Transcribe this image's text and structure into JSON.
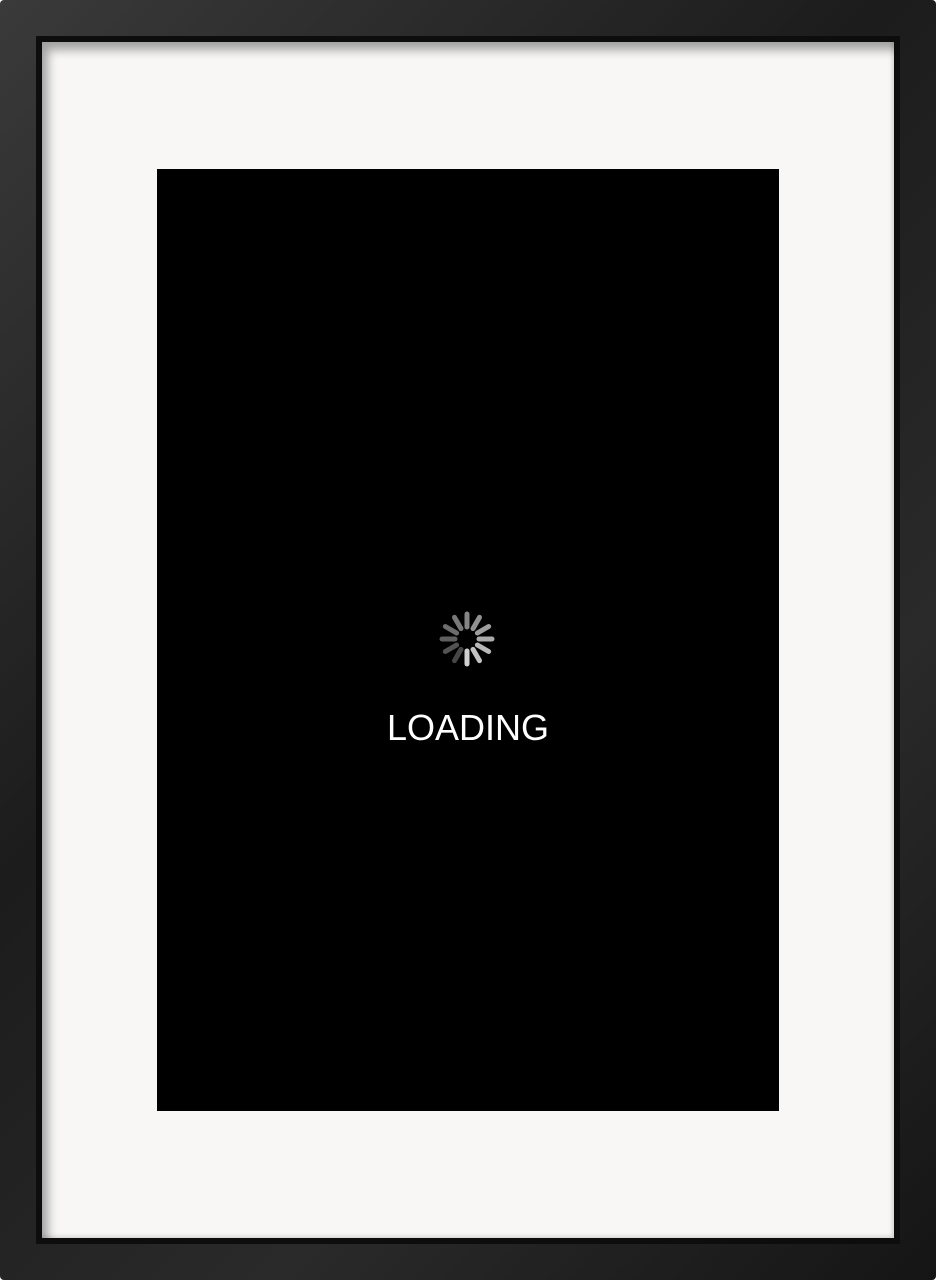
{
  "screen": {
    "loading_label": "LOADING",
    "spinner_icon": "activity-spinner-icon",
    "background_color": "#000000",
    "text_color": "#ffffff"
  },
  "frame": {
    "color": "#1c1c1c",
    "mat_color": "#f8f7f6"
  }
}
